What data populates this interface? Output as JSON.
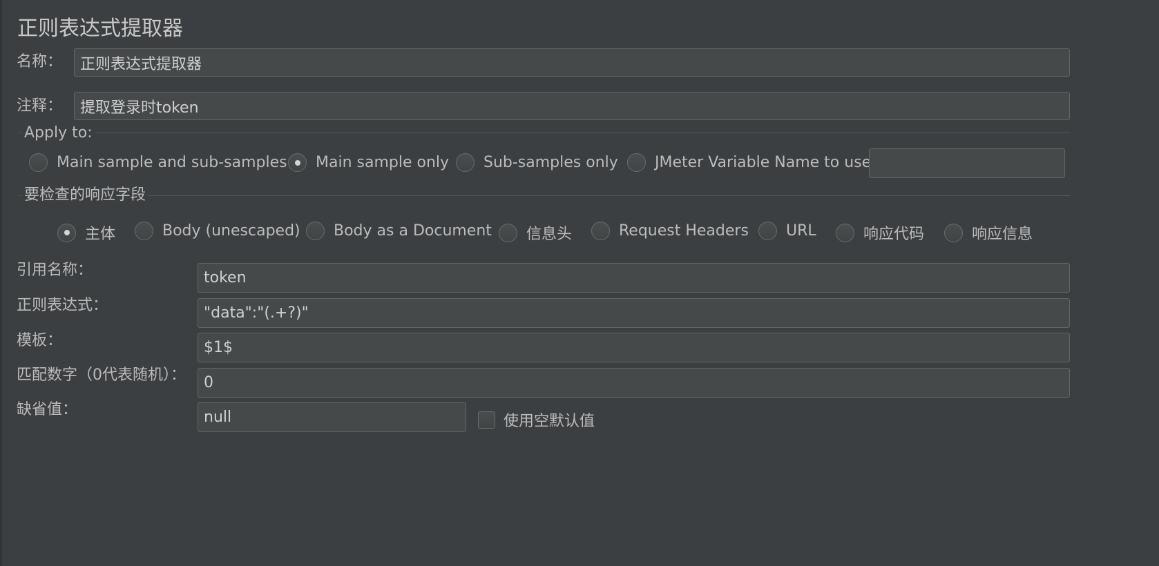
{
  "panel": {
    "title": "正则表达式提取器"
  },
  "name_row": {
    "label": "名称：",
    "value": "正则表达式提取器"
  },
  "comment_row": {
    "label": "注释：",
    "value": "提取登录时token"
  },
  "apply_to": {
    "title": "Apply to:",
    "options": [
      {
        "label": "Main sample and sub-samples",
        "selected": false
      },
      {
        "label": "Main sample only",
        "selected": true
      },
      {
        "label": "Sub-samples only",
        "selected": false
      },
      {
        "label": "JMeter Variable Name to use",
        "selected": false
      }
    ],
    "variable_value": ""
  },
  "field_to_check": {
    "title": "要检查的响应字段",
    "options": [
      {
        "label": "主体",
        "selected": true
      },
      {
        "label": "Body (unescaped)",
        "selected": false
      },
      {
        "label": "Body as a Document",
        "selected": false
      },
      {
        "label": "信息头",
        "selected": false
      },
      {
        "label": "Request Headers",
        "selected": false
      },
      {
        "label": "URL",
        "selected": false
      },
      {
        "label": "响应代码",
        "selected": false
      },
      {
        "label": "响应信息",
        "selected": false
      }
    ]
  },
  "form": {
    "ref_name": {
      "label": "引用名称：",
      "value": "token"
    },
    "regex": {
      "label": "正则表达式：",
      "value": "\"data\":\"(.+?)\""
    },
    "template": {
      "label": "模板：",
      "value": "$1$"
    },
    "match_no": {
      "label": "匹配数字（0代表随机）：",
      "value": "0"
    },
    "default_value": {
      "label": "缺省值：",
      "value": "null"
    },
    "use_empty_default": {
      "label": "使用空默认值",
      "checked": false
    }
  },
  "colors": {
    "background": "#3c3f41",
    "field_background": "#45494a",
    "field_border": "#646464",
    "text": "#bbbbbb"
  }
}
